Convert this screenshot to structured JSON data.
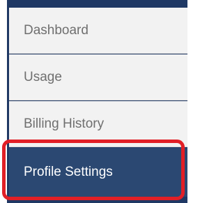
{
  "sidebar": {
    "items": [
      {
        "label": "Dashboard",
        "active": false
      },
      {
        "label": "Usage",
        "active": false
      },
      {
        "label": "Billing History",
        "active": false
      },
      {
        "label": "Profile Settings",
        "active": true
      }
    ]
  },
  "colors": {
    "active_background": "#2b4872",
    "item_background": "#f2f2f2",
    "item_text": "#6f6f6f",
    "active_text": "#ffffff",
    "highlight_border": "#e11f26"
  }
}
